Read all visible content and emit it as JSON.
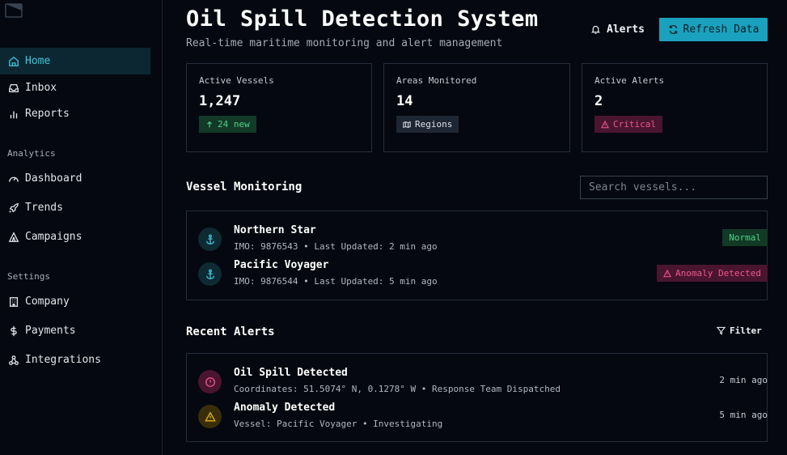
{
  "sidebar": {
    "primary": [
      {
        "label": "Home",
        "icon": "home-icon"
      },
      {
        "label": "Inbox",
        "icon": "inbox-icon"
      },
      {
        "label": "Reports",
        "icon": "bar-chart-icon"
      }
    ],
    "analytics_label": "Analytics",
    "analytics": [
      {
        "label": "Dashboard",
        "icon": "gauge-icon"
      },
      {
        "label": "Trends",
        "icon": "rocket-icon"
      },
      {
        "label": "Campaigns",
        "icon": "tent-icon"
      }
    ],
    "settings_label": "Settings",
    "settings": [
      {
        "label": "Company",
        "icon": "building-icon"
      },
      {
        "label": "Payments",
        "icon": "dollar-icon"
      },
      {
        "label": "Integrations",
        "icon": "webhook-icon"
      }
    ]
  },
  "header": {
    "title": "Oil Spill Detection System",
    "subtitle": "Real-time maritime monitoring and alert management",
    "alerts_label": "Alerts",
    "refresh_label": "Refresh Data"
  },
  "stats": [
    {
      "label": "Active Vessels",
      "value": "1,247",
      "badge": "24 new"
    },
    {
      "label": "Areas Monitored",
      "value": "14",
      "badge": "Regions"
    },
    {
      "label": "Active Alerts",
      "value": "2",
      "badge": "Critical"
    }
  ],
  "vessels": {
    "title": "Vessel Monitoring",
    "search_placeholder": "Search vessels...",
    "items": [
      {
        "name": "Northern Star",
        "meta": "IMO: 9876543 • Last Updated: 2 min ago",
        "status": "Normal"
      },
      {
        "name": "Pacific Voyager",
        "meta": "IMO: 9876544 • Last Updated: 5 min ago",
        "status": "Anomaly Detected"
      }
    ]
  },
  "alerts": {
    "title": "Recent Alerts",
    "filter_label": "Filter",
    "items": [
      {
        "title": "Oil Spill Detected",
        "meta": "Coordinates: 51.5074° N, 0.1278° W • Response Team Dispatched",
        "time": "2 min ago"
      },
      {
        "title": "Anomaly Detected",
        "meta": "Vessel: Pacific Voyager • Investigating",
        "time": "5 min ago"
      }
    ]
  },
  "colors": {
    "accent": "#1aa1bd",
    "success": "#4ed28a",
    "danger": "#f0578f",
    "warning": "#e0b020"
  }
}
